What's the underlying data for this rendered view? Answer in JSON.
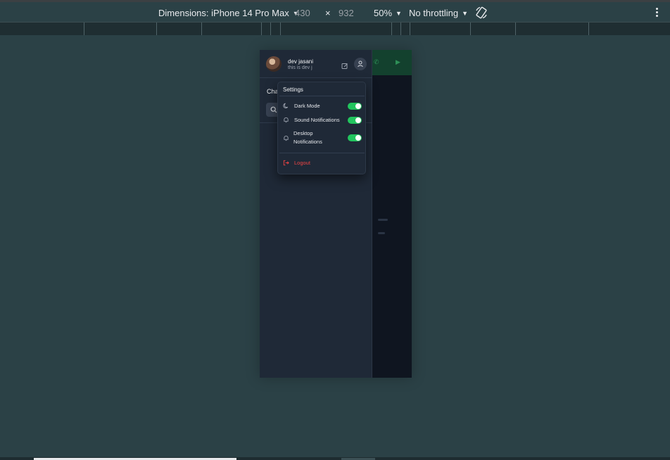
{
  "devtools": {
    "dimensions_label": "Dimensions: iPhone 14 Pro Max",
    "width_value": "430",
    "times_symbol": "×",
    "height_value": "932",
    "zoom_label": "50%",
    "throttle_label": "No throttling"
  },
  "app": {
    "user": {
      "name": "dev jasani",
      "status": "this is dev j"
    },
    "chats_title_partial": "Cha",
    "settings_menu": {
      "title": "Settings",
      "items": [
        {
          "label": "Dark Mode",
          "icon": "moon-icon",
          "toggle_on": true
        },
        {
          "label": "Sound Notifications",
          "icon": "bell-icon",
          "toggle_on": true
        },
        {
          "label_line1": "Desktop",
          "label_line2": "Notifications",
          "icon": "bell-icon",
          "toggle_on": true
        }
      ],
      "logout_label": "Logout"
    }
  },
  "colors": {
    "accent": "#22c55e",
    "danger": "#ef4444",
    "panel": "#1f2937",
    "page_bg": "#2b4146"
  }
}
